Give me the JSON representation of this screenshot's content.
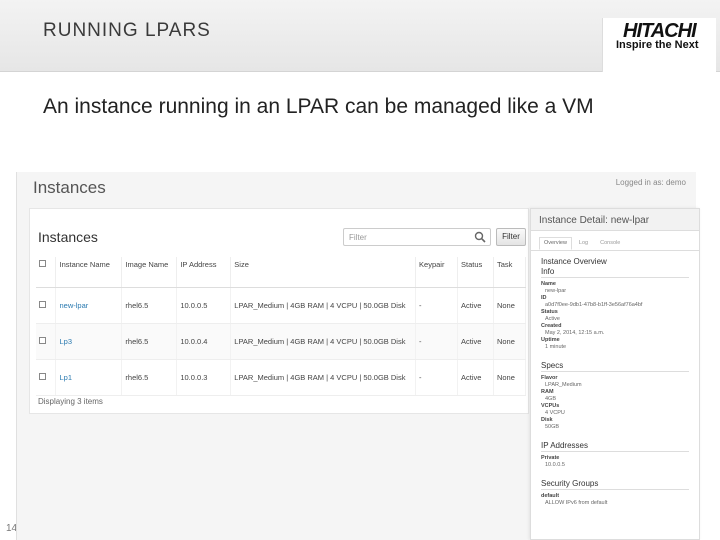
{
  "slide": {
    "title": "RUNNING LPARS",
    "subtitle": "An instance running in an LPAR can be managed like a VM",
    "page_number": "14",
    "brand": {
      "name": "HITACHI",
      "tagline": "Inspire the Next"
    }
  },
  "app": {
    "title": "Instances",
    "logged_in": "Logged in as: demo"
  },
  "instances_panel": {
    "title": "Instances",
    "filter_placeholder": "Filter",
    "filter_button": "Filter",
    "columns": [
      "",
      "Instance Name",
      "Image Name",
      "IP Address",
      "Size",
      "Keypair",
      "Status",
      "Task"
    ],
    "rows": [
      {
        "name": "new-lpar",
        "image": "rhel6.5",
        "ip": "10.0.0.5",
        "size": "LPAR_Medium | 4GB RAM | 4 VCPU | 50.0GB Disk",
        "keypair": "-",
        "status": "Active",
        "task": "None"
      },
      {
        "name": "Lp3",
        "image": "rhel6.5",
        "ip": "10.0.0.4",
        "size": "LPAR_Medium | 4GB RAM | 4 VCPU | 50.0GB Disk",
        "keypair": "-",
        "status": "Active",
        "task": "None"
      },
      {
        "name": "Lp1",
        "image": "rhel6.5",
        "ip": "10.0.0.3",
        "size": "LPAR_Medium | 4GB RAM | 4 VCPU | 50.0GB Disk",
        "keypair": "-",
        "status": "Active",
        "task": "None"
      }
    ],
    "footer": "Displaying 3 items"
  },
  "detail_panel": {
    "title": "Instance Detail: new-lpar",
    "tabs": [
      "Overview",
      "Log",
      "Console"
    ],
    "overview_title": "Instance Overview",
    "info_title": "Info",
    "info": [
      {
        "label": "Name",
        "value": "new-lpar"
      },
      {
        "label": "ID",
        "value": "a0d7f0ee-9db1-47b8-b1ff-3e56af76a4bf"
      },
      {
        "label": "Status",
        "value": "Active"
      },
      {
        "label": "Created",
        "value": "May 2, 2014, 12:15 a.m."
      },
      {
        "label": "Uptime",
        "value": "1 minute"
      }
    ],
    "specs_title": "Specs",
    "specs": [
      {
        "label": "Flavor",
        "value": "LPAR_Medium"
      },
      {
        "label": "RAM",
        "value": "4GB"
      },
      {
        "label": "VCPUs",
        "value": "4 VCPU"
      },
      {
        "label": "Disk",
        "value": "50GB"
      }
    ],
    "ip_title": "IP Addresses",
    "ip": [
      {
        "label": "Private",
        "value": "10.0.0.5"
      }
    ],
    "sg_title": "Security Groups",
    "sg": [
      {
        "label": "default",
        "value": "ALLOW IPv6 from default"
      }
    ]
  }
}
